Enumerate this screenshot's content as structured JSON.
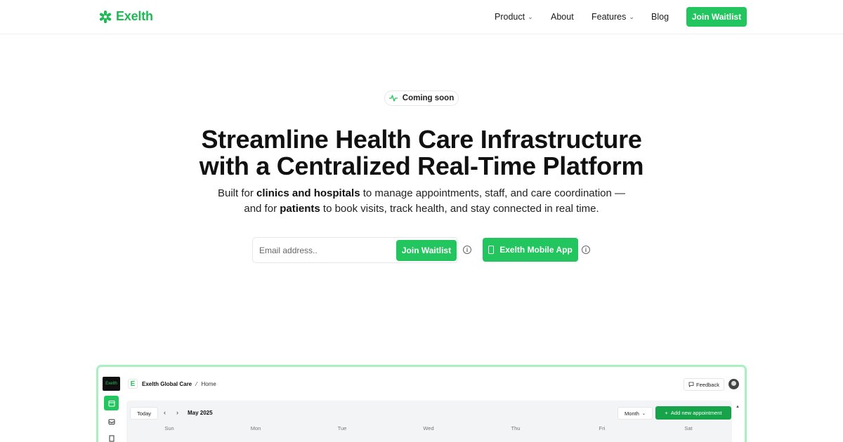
{
  "brand": {
    "name": "Exelth",
    "color": "#1fb955"
  },
  "nav": {
    "items": [
      {
        "label": "Product",
        "dropdown": true
      },
      {
        "label": "About",
        "dropdown": false
      },
      {
        "label": "Features",
        "dropdown": true
      },
      {
        "label": "Blog",
        "dropdown": false
      }
    ],
    "cta": "Join Waitlist"
  },
  "hero": {
    "badge": "Coming soon",
    "title_line1": "Streamline Health Care Infrastructure",
    "title_line2": "with a Centralized Real-Time Platform",
    "sub_line1": {
      "a": "Built for ",
      "b": "clinics and hospitals",
      "c": " to manage appointments, staff, and care coordination —"
    },
    "sub_line2": {
      "a": "and for ",
      "b": "patients",
      "c": " to book visits, track health, and stay connected in real time."
    },
    "email_placeholder": "Email address..",
    "join_label": "Join Waitlist",
    "app_label": "Exelth Mobile App"
  },
  "preview": {
    "logo_text": "Exelth",
    "org_initial": "E",
    "org_name": "Exelth Global Care",
    "breadcrumb": "Home",
    "feedback": "Feedback",
    "today": "Today",
    "month_label": "May 2025",
    "view_select": "Month",
    "add_button": "Add new appointment",
    "weekdays": [
      "Sun",
      "Mon",
      "Tue",
      "Wed",
      "Thu",
      "Fri",
      "Sat"
    ]
  },
  "colors": {
    "accent": "#22c55e",
    "accent_dark": "#16a34a",
    "preview_border": "#a7f0c0"
  }
}
